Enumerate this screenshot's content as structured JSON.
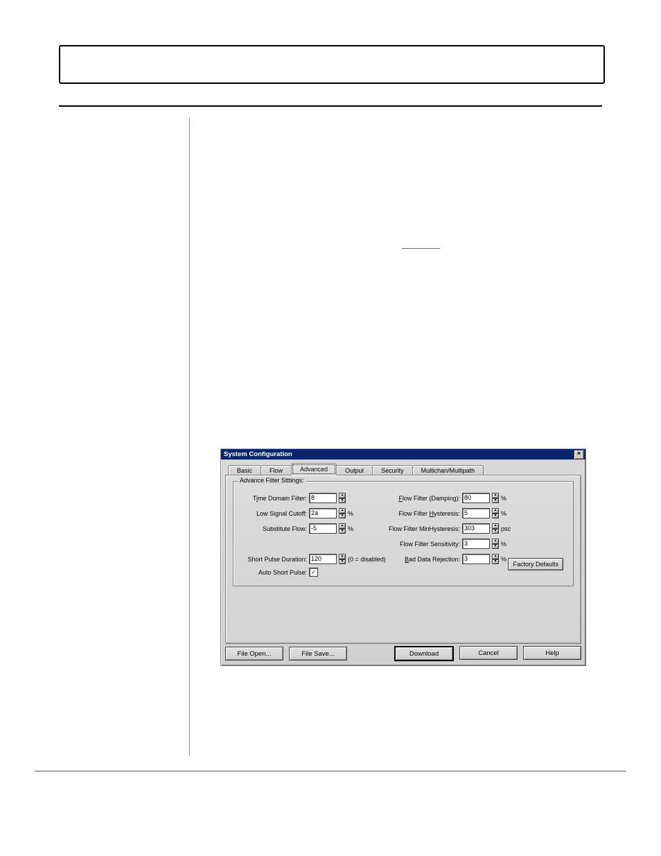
{
  "dialog": {
    "title": "System Configuration",
    "tabs": {
      "basic": "Basic",
      "flow": "Flow",
      "advanced": "Advanced",
      "output": "Output",
      "security": "Security",
      "multichan": "Multichan/Multipath"
    },
    "group_label": "Advance Filter Stttings:",
    "left": {
      "time_domain_label_pre": "T",
      "time_domain_label_u": "i",
      "time_domain_label_post": "me Domain Filter:",
      "time_domain_value": "8",
      "low_signal_label": "Low Signal Cutoff:",
      "low_signal_value": "2a",
      "low_signal_unit": "%",
      "substitute_label": "Substitute Flow:",
      "substitute_value": "-5",
      "substitute_unit": "%",
      "short_pulse_label": "Short Pulse Duration:",
      "short_pulse_value": "120",
      "short_pulse_hint": "(0 = disabled)",
      "auto_short_label": "Auto Short Pulse:"
    },
    "right": {
      "flow_filter_label_u": "F",
      "flow_filter_label_post": "low Filter (Damping):",
      "flow_filter_value": "80",
      "flow_filter_unit": "%",
      "hyst_label_pre": "Flow Filter ",
      "hyst_label_u": "H",
      "hyst_label_post": "ysteresis:",
      "hyst_value": "5",
      "hyst_unit": "%",
      "minhyst_label": "Flow Filter MinHysteresis:",
      "minhyst_value": "303",
      "minhyst_unit": "psc",
      "sens_label": "Flow Filter Sensitivity:",
      "sens_value": "3",
      "sens_unit": "%",
      "bad_label_u": "B",
      "bad_label_post": "ad Data Rejection:",
      "bad_value": "3",
      "bad_unit": "%"
    },
    "factory_defaults": "Factory Defaults",
    "file_open": "File Open...",
    "file_save": "File Save...",
    "download": "Download",
    "cancel": "Cancel",
    "help": "Help"
  }
}
